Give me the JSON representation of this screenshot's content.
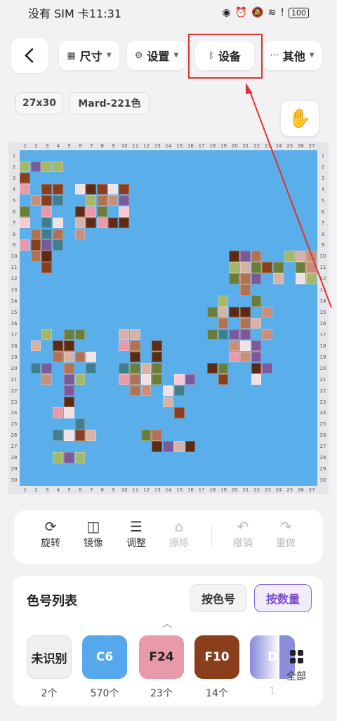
{
  "status_bar": {
    "carrier_time": "没有 SIM 卡11:31",
    "battery": "100",
    "icons": [
      "eye-icon",
      "alarm-icon",
      "mute-icon",
      "wifi-icon",
      "alert-icon"
    ]
  },
  "toolbar": {
    "back_icon": "chevron-left-icon",
    "size_label": "尺寸",
    "settings_label": "设置",
    "device_label": "设备",
    "other_label": "其他"
  },
  "chips": {
    "dimensions": "27x30",
    "palette": "Mard-221色"
  },
  "grid": {
    "columns": 27,
    "rows": 30,
    "base_color": "#5aaeea",
    "highlight_color": "#e0322f"
  },
  "actions": [
    {
      "label": "旋转",
      "icon": "rotate-icon",
      "enabled": true
    },
    {
      "label": "镜像",
      "icon": "mirror-icon",
      "enabled": true
    },
    {
      "label": "调整",
      "icon": "sliders-icon",
      "enabled": true
    },
    {
      "label": "擦除",
      "icon": "brush-icon",
      "enabled": false
    },
    {
      "label": "撤销",
      "icon": "undo-icon",
      "enabled": false
    },
    {
      "label": "重做",
      "icon": "redo-icon",
      "enabled": false
    }
  ],
  "color_list": {
    "title": "色号列表",
    "sort_by_code": "按色号",
    "sort_by_count": "按数量",
    "all_label": "全部",
    "swatches": [
      {
        "code": "未识别",
        "count": "2个",
        "color": "#efefef",
        "text_color": "#222"
      },
      {
        "code": "C6",
        "count": "570个",
        "color": "#55a8ec",
        "text_color": "#ffffff"
      },
      {
        "code": "F24",
        "count": "23个",
        "color": "#e89aaa",
        "text_color": "#222"
      },
      {
        "code": "F10",
        "count": "14个",
        "color": "#8a3e1c",
        "text_color": "#ffffff"
      },
      {
        "code": "D",
        "count": "1",
        "color": "#8a8fdc",
        "text_color": "#ffffff"
      }
    ]
  }
}
